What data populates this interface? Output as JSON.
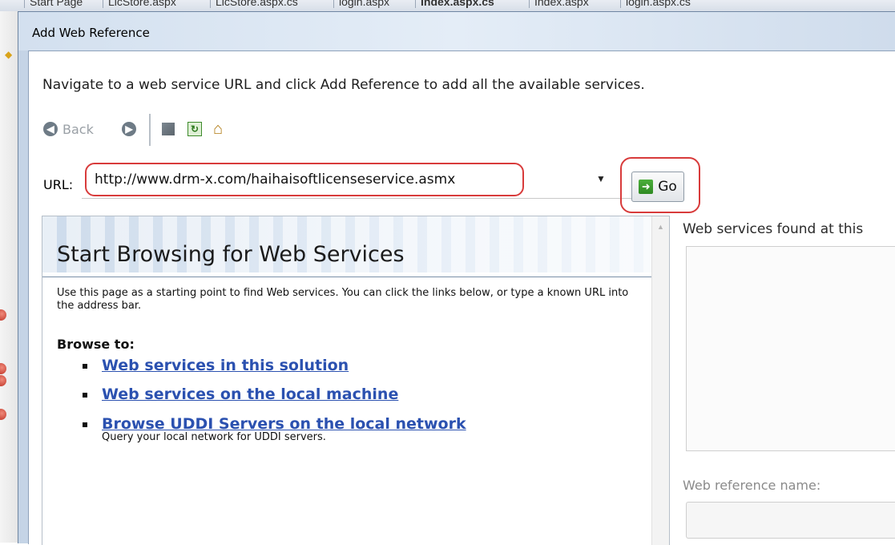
{
  "editor_tabs": [
    "Start Page",
    "LicStore.aspx",
    "LicStore.aspx.cs",
    "login.aspx",
    "Index.aspx.cs",
    "Index.aspx",
    "login.aspx.cs"
  ],
  "dialog": {
    "title": "Add Web Reference",
    "instructions": "Navigate to a web service URL and click Add Reference to add all the available services."
  },
  "toolbar": {
    "back_label": "Back",
    "icons": [
      "back-arrow-icon",
      "forward-arrow-icon",
      "stop-icon",
      "refresh-icon",
      "home-icon"
    ]
  },
  "url": {
    "label": "URL:",
    "value": "http://www.drm-x.com/haihaisoftlicenseservice.asmx",
    "go_label": "Go"
  },
  "browser": {
    "heading": "Start Browsing for Web Services",
    "intro": "Use this page as a starting point to find Web services. You can click the links below, or type a known URL into the address bar.",
    "browse_to": "Browse to:",
    "links": [
      {
        "label": "Web services in this solution",
        "description": ""
      },
      {
        "label": "Web services on the local machine",
        "description": ""
      },
      {
        "label": "Browse UDDI Servers on the local network",
        "description": "Query your local network for UDDI servers."
      }
    ]
  },
  "right_panel": {
    "found_label": "Web services found at this",
    "ref_name_label": "Web reference name:",
    "ref_name_value": ""
  },
  "colors": {
    "highlight": "#d83b3b",
    "link": "#2b51b0",
    "dialog_frame": "#c5d4e6"
  }
}
